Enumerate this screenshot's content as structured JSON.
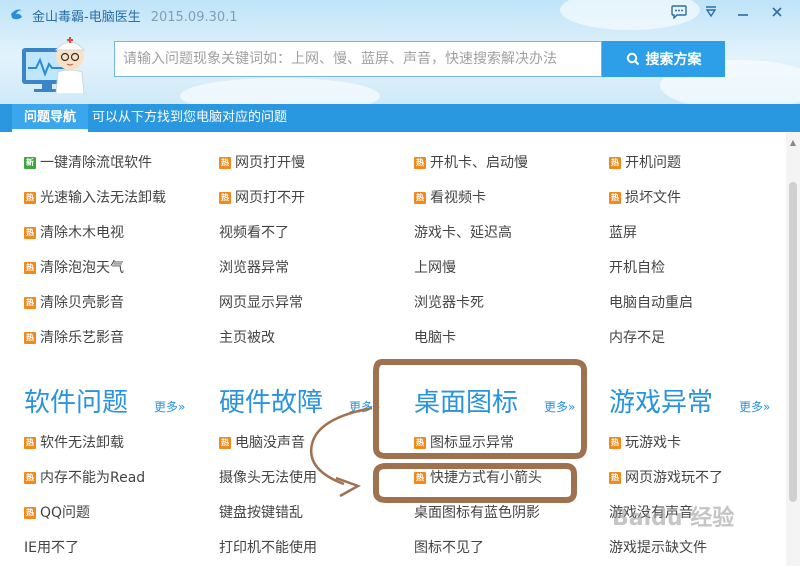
{
  "app": {
    "title": "金山毒霸-电脑医生",
    "version": "2015.09.30.1"
  },
  "titlebar": {
    "buttons": [
      {
        "name": "chat-icon",
        "glyph": "💬"
      },
      {
        "name": "menu-icon",
        "glyph": "▽"
      },
      {
        "name": "minimize-icon",
        "glyph": "—"
      },
      {
        "name": "close-icon",
        "glyph": "✕"
      }
    ]
  },
  "search": {
    "placeholder": "请输入问题现象关键词如：上网、慢、蓝屏、声音，快速搜索解决办法",
    "button_label": "搜索方案"
  },
  "nav": {
    "active": "问题导航",
    "hint": "可以从下方找到您电脑对应的问题"
  },
  "top_columns": [
    [
      {
        "text": "一键清除流氓软件",
        "badge": "新"
      },
      {
        "text": "光速输入法无法卸载",
        "badge": "热"
      },
      {
        "text": "清除木木电视",
        "badge": "热"
      },
      {
        "text": "清除泡泡天气",
        "badge": "热"
      },
      {
        "text": "清除贝壳影音",
        "badge": "热"
      },
      {
        "text": "清除乐艺影音",
        "badge": "热"
      }
    ],
    [
      {
        "text": "网页打开慢",
        "badge": "热"
      },
      {
        "text": "网页打不开",
        "badge": "热"
      },
      {
        "text": "视频看不了",
        "badge": ""
      },
      {
        "text": "浏览器异常",
        "badge": ""
      },
      {
        "text": "网页显示异常",
        "badge": ""
      },
      {
        "text": "主页被改",
        "badge": ""
      }
    ],
    [
      {
        "text": "开机卡、启动慢",
        "badge": "热"
      },
      {
        "text": "看视频卡",
        "badge": "热"
      },
      {
        "text": "游戏卡、延迟高",
        "badge": ""
      },
      {
        "text": "上网慢",
        "badge": ""
      },
      {
        "text": "浏览器卡死",
        "badge": ""
      },
      {
        "text": "电脑卡",
        "badge": ""
      }
    ],
    [
      {
        "text": "开机问题",
        "badge": "热"
      },
      {
        "text": "损坏文件",
        "badge": "热"
      },
      {
        "text": "蓝屏",
        "badge": ""
      },
      {
        "text": "开机自检",
        "badge": ""
      },
      {
        "text": "电脑自动重启",
        "badge": ""
      },
      {
        "text": "内存不足",
        "badge": ""
      }
    ]
  ],
  "categories": [
    {
      "title": "软件问题",
      "more": "更多»",
      "items": [
        {
          "text": "软件无法卸载",
          "badge": "热"
        },
        {
          "text": "内存不能为Read",
          "badge": "热"
        },
        {
          "text": "QQ问题",
          "badge": "热"
        },
        {
          "text": "IE用不了",
          "badge": ""
        }
      ]
    },
    {
      "title": "硬件故障",
      "more": "更多»",
      "items": [
        {
          "text": "电脑没声音",
          "badge": "热"
        },
        {
          "text": "摄像头无法使用",
          "badge": ""
        },
        {
          "text": "键盘按键错乱",
          "badge": ""
        },
        {
          "text": "打印机不能使用",
          "badge": ""
        }
      ]
    },
    {
      "title": "桌面图标",
      "more": "更多»",
      "items": [
        {
          "text": "图标显示异常",
          "badge": "热"
        },
        {
          "text": "快捷方式有小箭头",
          "badge": "热"
        },
        {
          "text": "桌面图标有蓝色阴影",
          "badge": ""
        },
        {
          "text": "图标不见了",
          "badge": ""
        }
      ]
    },
    {
      "title": "游戏异常",
      "more": "更多»",
      "items": [
        {
          "text": "玩游戏卡",
          "badge": "热"
        },
        {
          "text": "网页游戏玩不了",
          "badge": "热"
        },
        {
          "text": "游戏没有声音",
          "badge": ""
        },
        {
          "text": "游戏提示缺文件",
          "badge": ""
        }
      ]
    }
  ],
  "watermark": "Baidu 经验",
  "colors": {
    "accent": "#2a98e0",
    "hot_badge": "#f08a1c",
    "new_badge": "#3fa83a",
    "annotation": "#a0714f"
  }
}
